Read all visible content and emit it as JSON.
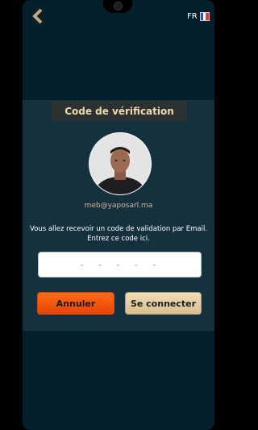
{
  "header": {
    "back_icon": "chevron-left-icon",
    "language": "FR",
    "flag_icon": "flag-france-icon"
  },
  "card": {
    "title": "Code de vérification",
    "avatar_icon": "user-avatar",
    "email": "meb@yaposarl.ma",
    "info_line1": "Vous allez recevoir un code de validation par Email.",
    "info_line2": "Entrez ce code ici."
  },
  "code_field": {
    "placeholder": "- - - - -",
    "value": ""
  },
  "buttons": {
    "cancel_label": "Annuler",
    "connect_label": "Se connecter"
  },
  "colors": {
    "background": "#04202c",
    "card": "#16313e",
    "accent_gold": "#f0d9ae",
    "cancel": "#ff6a17"
  }
}
